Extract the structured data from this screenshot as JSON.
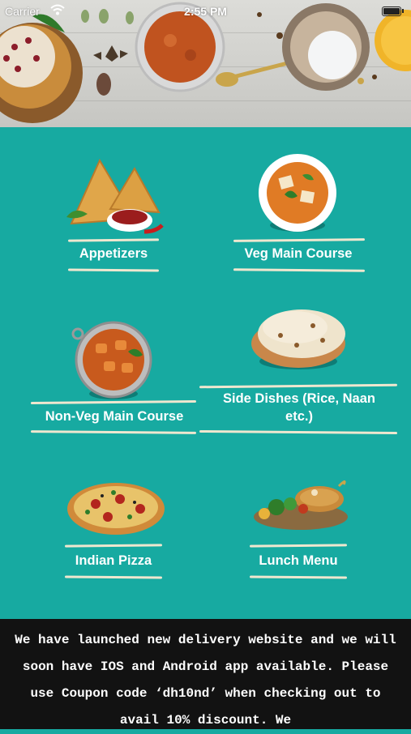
{
  "status_bar": {
    "carrier": "Carrier",
    "time": "2:55 PM"
  },
  "colors": {
    "background": "#17aaa1",
    "label_text": "#ffffff",
    "divider": "#efe7cf",
    "footer_background": "#121212"
  },
  "categories": [
    {
      "label": "Appetizers",
      "icon": "samosa-icon"
    },
    {
      "label": "Veg Main Course",
      "icon": "veg-curry-bowl-icon"
    },
    {
      "label": "Non-Veg Main Course",
      "icon": "chicken-curry-handi-icon"
    },
    {
      "label": "Side Dishes (Rice, Naan etc.)",
      "icon": "naan-bread-icon"
    },
    {
      "label": "Indian Pizza",
      "icon": "pizza-icon"
    },
    {
      "label": "Lunch Menu",
      "icon": "lunch-platter-icon"
    }
  ],
  "announcement": {
    "text": "We have launched new delivery website and we will soon have IOS and Android app available. Please use Coupon code ‘dh10nd’ when checking out to avail 10% discount. We"
  }
}
